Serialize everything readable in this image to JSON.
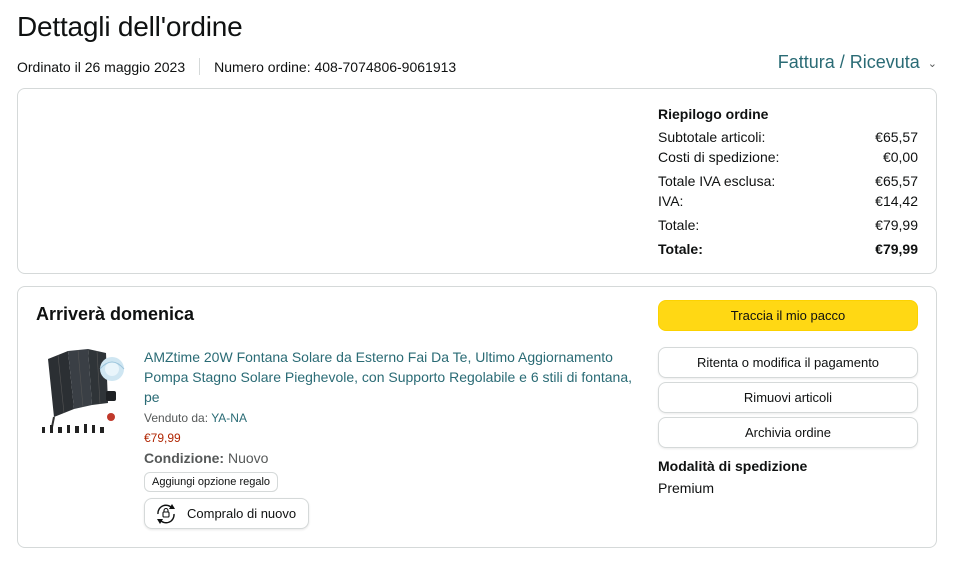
{
  "page": {
    "title": "Dettagli dell'ordine",
    "ordered_on": "Ordinato il 26 maggio 2023",
    "order_number": "Numero ordine: 408-7074806-9061913",
    "invoice_link": "Fattura / Ricevuta"
  },
  "summary": {
    "title": "Riepilogo ordine",
    "rows": [
      {
        "label": "Subtotale articoli:",
        "value": "€65,57"
      },
      {
        "label": "Costi di spedizione:",
        "value": "€0,00"
      },
      {
        "label": "Totale IVA esclusa:",
        "value": "€65,57"
      },
      {
        "label": "IVA:",
        "value": "€14,42"
      },
      {
        "label": "Totale:",
        "value": "€79,99"
      },
      {
        "label": "Totale:",
        "value": "€79,99"
      }
    ]
  },
  "shipment": {
    "arrives": "Arriverà domenica",
    "product": {
      "title": "AMZtime 20W Fontana Solare da Esterno Fai Da Te, Ultimo Aggiornamento Pompa Stagno Solare Pieghevole, con Supporto Regolabile e 6 stili di fontana, pe",
      "sold_by_label": "Venduto da:",
      "seller": "YA-NA",
      "price": "€79,99",
      "condition_label": "Condizione:",
      "condition_value": "Nuovo",
      "gift_button": "Aggiungi opzione regalo",
      "rebuy_button": "Compralo di nuovo"
    },
    "actions": {
      "track": "Traccia il mio pacco",
      "retry_payment": "Ritenta o modifica il pagamento",
      "remove_items": "Rimuovi articoli",
      "archive": "Archivia ordine"
    },
    "shipping_method_label": "Modalità di spedizione",
    "shipping_method_value": "Premium"
  },
  "colors": {
    "link": "#2a6b75",
    "price": "#b12704",
    "primary_button": "#ffd814",
    "border": "#d5d9d9"
  }
}
